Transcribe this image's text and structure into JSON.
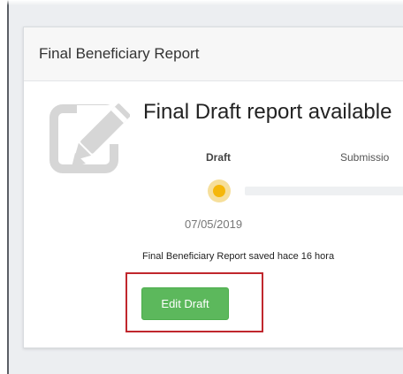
{
  "panel": {
    "title": "Final Beneficiary Report"
  },
  "status": {
    "title": "Final Draft report available",
    "icon": "edit-document-icon"
  },
  "steps": [
    {
      "label": "Draft",
      "date": "07/05/2019"
    },
    {
      "label": "Submissio"
    }
  ],
  "saved_note": "Final Beneficiary Report saved hace 16 hora",
  "actions": {
    "edit_draft_label": "Edit Draft"
  },
  "colors": {
    "button_green": "#5cb85c",
    "step_active": "#f5b70a",
    "highlight_red": "#c0272d"
  }
}
